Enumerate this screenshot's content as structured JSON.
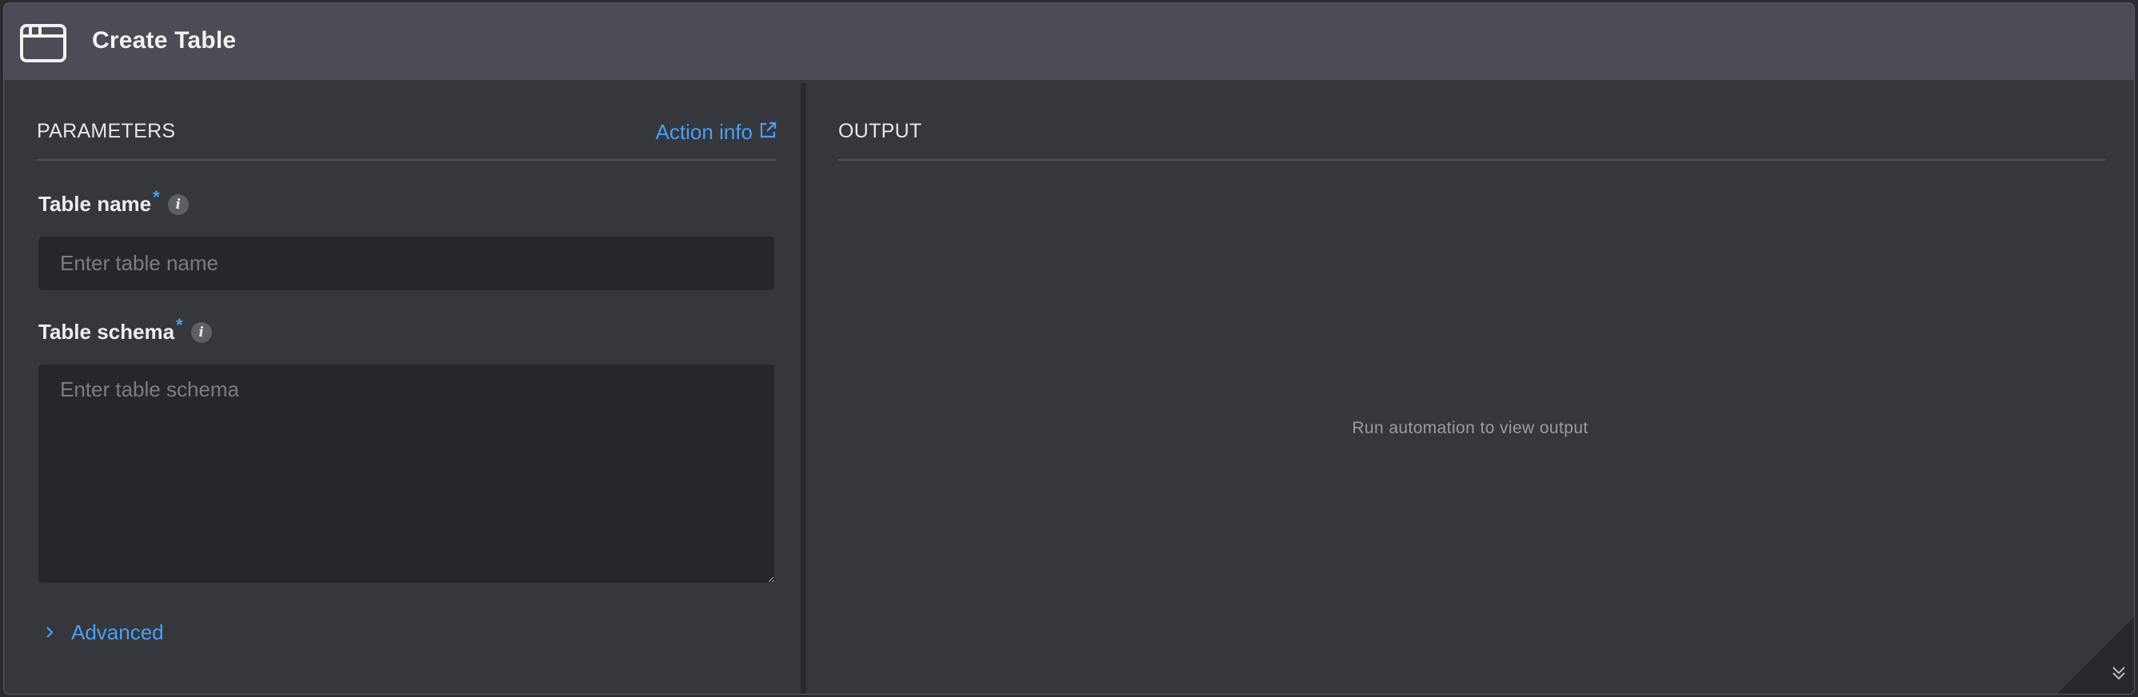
{
  "window": {
    "title": "Create Table",
    "icon": "browser-window-icon"
  },
  "parameters": {
    "heading": "PARAMETERS",
    "action_info": "Action info",
    "action_info_icon": "external-link-icon",
    "fields": {
      "table_name": {
        "label": "Table name",
        "required_mark": "*",
        "info_glyph": "i",
        "placeholder": "Enter table name",
        "value": ""
      },
      "table_schema": {
        "label": "Table schema",
        "required_mark": "*",
        "info_glyph": "i",
        "placeholder": "Enter table schema",
        "value": ""
      }
    },
    "advanced": {
      "label": "Advanced",
      "icon": "chevron-right-icon"
    }
  },
  "output": {
    "heading": "OUTPUT",
    "empty_message": "Run automation to view output",
    "corner_icon": "double-chevron-down-icon"
  },
  "colors": {
    "titlebar": "#4b4c55",
    "panel": "#36373c",
    "input_bg": "#26272b",
    "accent": "#4a9ff2",
    "divider": "#2a2b2f"
  }
}
